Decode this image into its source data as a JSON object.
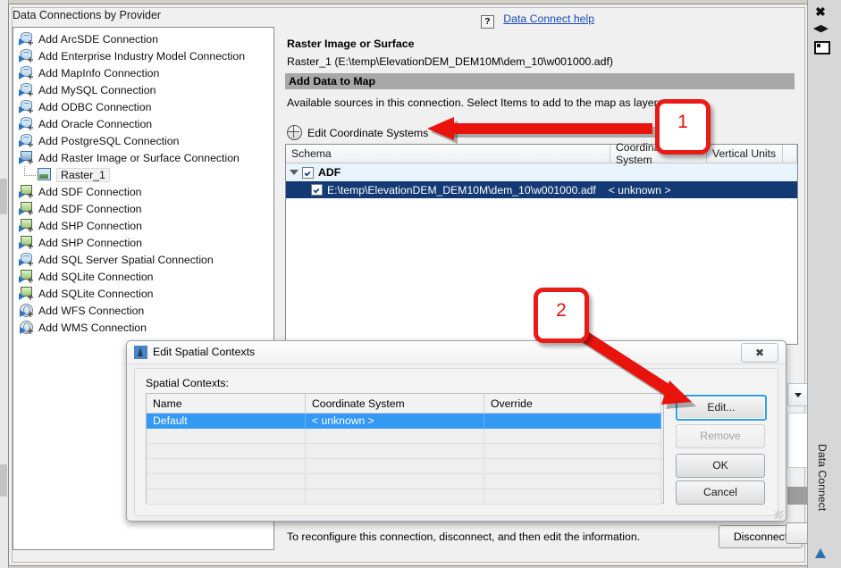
{
  "window": {
    "left_panel_title": "Data Connections by Provider",
    "connections": [
      {
        "label": "Add ArcSDE Connection",
        "icon": "database-connection-icon"
      },
      {
        "label": "Add Enterprise Industry Model Connection",
        "icon": "database-connection-icon"
      },
      {
        "label": "Add MapInfo Connection",
        "icon": "database-connection-icon"
      },
      {
        "label": "Add MySQL Connection",
        "icon": "database-connection-icon"
      },
      {
        "label": "Add ODBC Connection",
        "icon": "database-connection-icon"
      },
      {
        "label": "Add Oracle Connection",
        "icon": "database-connection-icon"
      },
      {
        "label": "Add PostgreSQL Connection",
        "icon": "database-connection-icon"
      },
      {
        "label": "Add Raster Image or Surface Connection",
        "icon": "raster-connection-icon"
      },
      {
        "label": "Raster_1",
        "icon": "raster-image-icon",
        "child": true
      },
      {
        "label": "Add SDF Connection",
        "icon": "file-connection-icon"
      },
      {
        "label": "Add SDF Connection",
        "icon": "file-connection-icon"
      },
      {
        "label": "Add SHP Connection",
        "icon": "file-connection-icon"
      },
      {
        "label": "Add SHP Connection",
        "icon": "file-connection-icon"
      },
      {
        "label": "Add SQL Server Spatial Connection",
        "icon": "database-connection-icon"
      },
      {
        "label": "Add SQLite Connection",
        "icon": "file-connection-icon"
      },
      {
        "label": "Add SQLite Connection",
        "icon": "file-connection-icon"
      },
      {
        "label": "Add WFS Connection",
        "icon": "web-connection-icon"
      },
      {
        "label": "Add WMS Connection",
        "icon": "web-connection-icon"
      }
    ]
  },
  "help": {
    "icon_label": "?",
    "link": "Data Connect help"
  },
  "provider": {
    "title": "Raster Image or Surface",
    "subtitle": "Raster_1 (E:\\temp\\ElevationDEM_DEM10M\\dem_10\\w001000.adf)",
    "section_bar": "Add Data to Map",
    "instruction": "Available sources in this connection.  Select Items to add to the map as layers.",
    "edit_coordinate_systems": "Edit Coordinate Systems"
  },
  "schema_grid": {
    "columns": [
      "Schema",
      "Coordinate System",
      "Vertical Units"
    ],
    "rows": [
      {
        "type": "group",
        "name": "ADF",
        "checked": true,
        "expanded": true
      },
      {
        "type": "item",
        "name": "E:\\temp\\ElevationDEM_DEM10M\\dem_10\\w001000.adf",
        "coordinate_system": "< unknown >",
        "checked": true,
        "selected": true
      }
    ]
  },
  "footer": {
    "message": "To reconfigure this connection, disconnect, and then edit the information.",
    "disconnect_label": "Disconnect"
  },
  "dialog": {
    "title": "Edit Spatial Contexts",
    "close_label": "✖",
    "group_label": "Spatial Contexts:",
    "columns": [
      "Name",
      "Coordinate System",
      "Override"
    ],
    "rows": [
      {
        "name": "Default",
        "coordinate_system": "< unknown >",
        "override": "",
        "selected": true
      }
    ],
    "empty_row_count": 5,
    "buttons": {
      "edit": "Edit...",
      "remove": "Remove",
      "ok": "OK",
      "cancel": "Cancel"
    }
  },
  "dock": {
    "label": "Data Connect",
    "close": "✖",
    "autohide": "◀▶",
    "menu": "menu"
  },
  "callouts": [
    {
      "number": "1"
    },
    {
      "number": "2"
    }
  ],
  "colors": {
    "callout_red": "#e8130d",
    "selection_blue": "#143a75",
    "dialog_selection_blue": "#3399f3",
    "link_blue": "#1c49b5",
    "section_bar_grey": "#a8a8a8"
  }
}
